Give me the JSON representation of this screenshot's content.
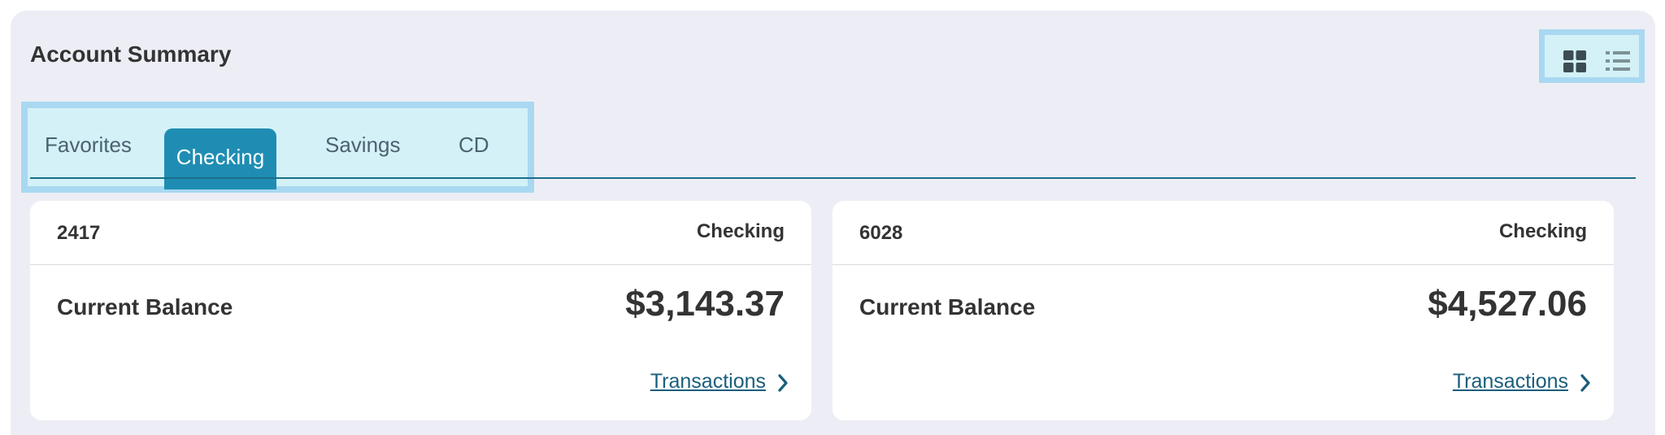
{
  "header": {
    "title": "Account Summary"
  },
  "view_toggle": {
    "grid_icon": "grid-view-icon",
    "list_icon": "list-view-icon"
  },
  "tabs": [
    {
      "label": "Favorites",
      "active": false
    },
    {
      "label": "Checking",
      "active": true
    },
    {
      "label": "Savings",
      "active": false
    },
    {
      "label": "CD",
      "active": false
    }
  ],
  "accounts": [
    {
      "number": "2417",
      "type": "Checking",
      "balance_label": "Current Balance",
      "balance": "$3,143.37",
      "link_label": "Transactions"
    },
    {
      "number": "6028",
      "type": "Checking",
      "balance_label": "Current Balance",
      "balance": "$4,527.06",
      "link_label": "Transactions"
    }
  ],
  "colors": {
    "panel_bg": "#edeef5",
    "active_tab": "#1f8db3",
    "link": "#1a5e7c",
    "highlight_border": "#a9d8f1",
    "highlight_fill": "#d3f1f7"
  }
}
